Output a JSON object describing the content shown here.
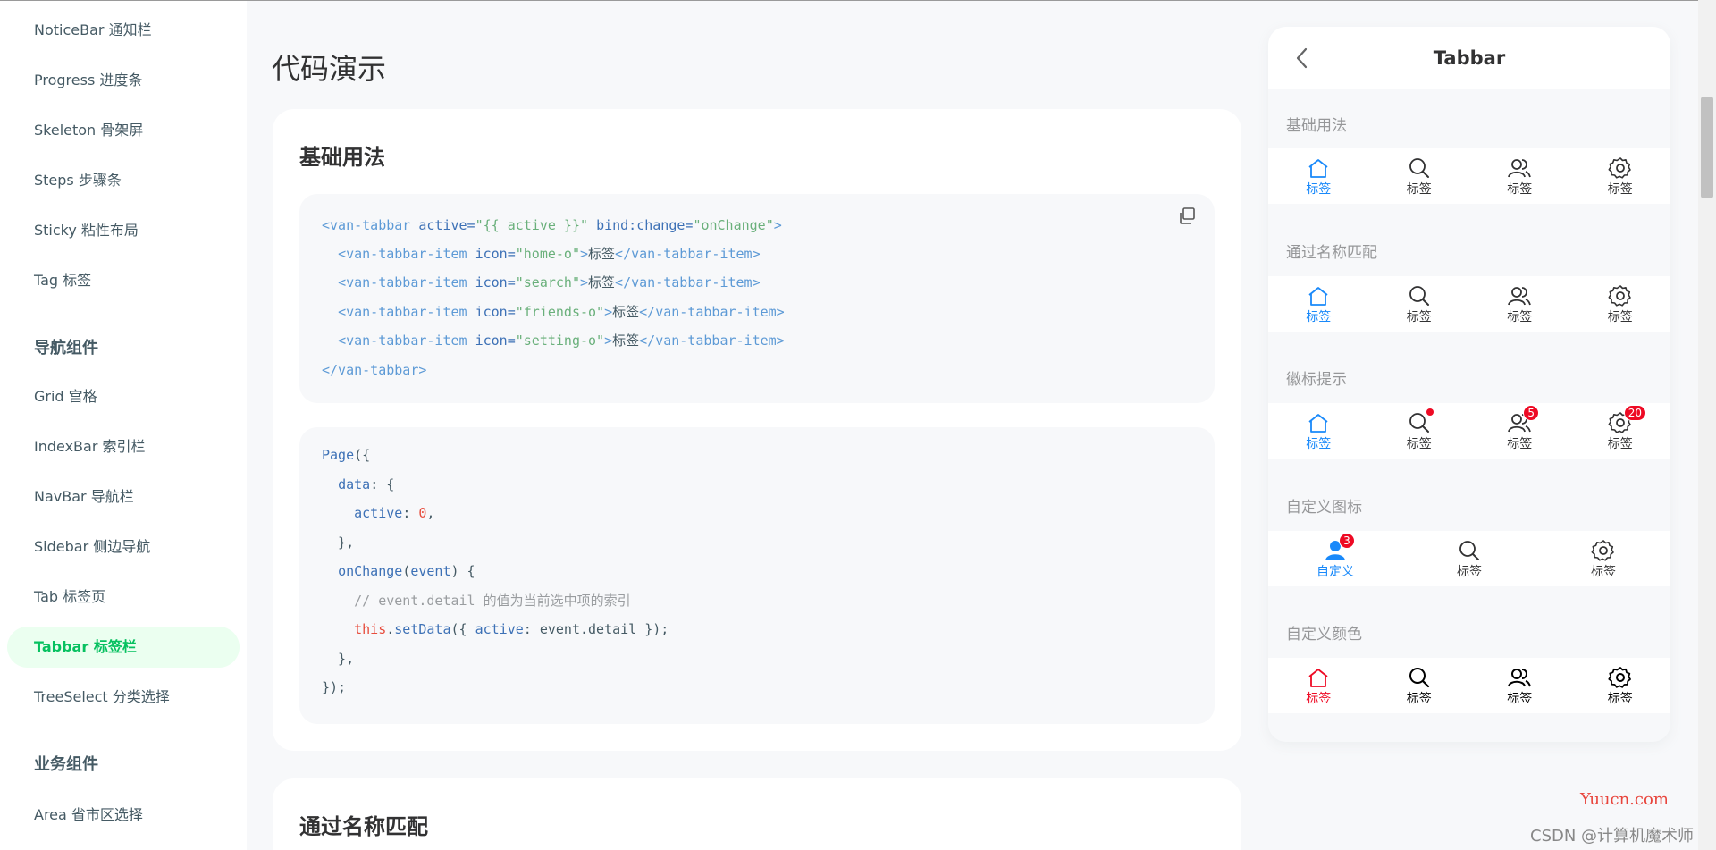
{
  "sidebar": {
    "items": [
      {
        "label": "NoticeBar 通知栏"
      },
      {
        "label": "Progress 进度条"
      },
      {
        "label": "Skeleton 骨架屏"
      },
      {
        "label": "Steps 步骤条"
      },
      {
        "label": "Sticky 粘性布局"
      },
      {
        "label": "Tag 标签"
      }
    ],
    "group_nav": "导航组件",
    "nav_items": [
      {
        "label": "Grid 宫格"
      },
      {
        "label": "IndexBar 索引栏"
      },
      {
        "label": "NavBar 导航栏"
      },
      {
        "label": "Sidebar 侧边导航"
      },
      {
        "label": "Tab 标签页"
      },
      {
        "label": "Tabbar 标签栏"
      },
      {
        "label": "TreeSelect 分类选择"
      }
    ],
    "group_business": "业务组件",
    "business_items": [
      {
        "label": "Area 省市区选择"
      }
    ],
    "active_color": "#07c160"
  },
  "main": {
    "page_title": "代码演示",
    "card1_title": "基础用法",
    "card2_title": "通过名称匹配",
    "code1": [
      "<van-tabbar active=\"{{ active }}\" bind:change=\"onChange\">",
      "  <van-tabbar-item icon=\"home-o\">标签</van-tabbar-item>",
      "  <van-tabbar-item icon=\"search\">标签</van-tabbar-item>",
      "  <van-tabbar-item icon=\"friends-o\">标签</van-tabbar-item>",
      "  <van-tabbar-item icon=\"setting-o\">标签</van-tabbar-item>",
      "</van-tabbar>"
    ],
    "code2": [
      "Page({",
      "  data: {",
      "    active: 0,",
      "  },",
      "  onChange(event) {",
      "    // event.detail 的值为当前选中项的索引",
      "    this.setData({ active: event.detail });",
      "  },",
      "});"
    ],
    "copy_icon": "copy-icon"
  },
  "simulator": {
    "title": "Tabbar",
    "back_icon": "chevron-left-icon",
    "sections": [
      {
        "title": "基础用法",
        "items": [
          {
            "icon": "home-o",
            "label": "标签"
          },
          {
            "icon": "search",
            "label": "标签"
          },
          {
            "icon": "friends-o",
            "label": "标签"
          },
          {
            "icon": "setting-o",
            "label": "标签"
          }
        ]
      },
      {
        "title": "通过名称匹配",
        "items": [
          {
            "icon": "home-o",
            "label": "标签"
          },
          {
            "icon": "search",
            "label": "标签"
          },
          {
            "icon": "friends-o",
            "label": "标签"
          },
          {
            "icon": "setting-o",
            "label": "标签"
          }
        ]
      },
      {
        "title": "徽标提示",
        "items": [
          {
            "icon": "home-o",
            "label": "标签"
          },
          {
            "icon": "search",
            "label": "标签",
            "dot": true
          },
          {
            "icon": "friends-o",
            "label": "标签",
            "badge": "5"
          },
          {
            "icon": "setting-o",
            "label": "标签",
            "badge": "20"
          }
        ]
      },
      {
        "title": "自定义图标",
        "items": [
          {
            "icon": "custom-user",
            "label": "自定义",
            "badge": "3"
          },
          {
            "icon": "search",
            "label": "标签"
          },
          {
            "icon": "setting-o",
            "label": "标签"
          }
        ]
      },
      {
        "title": "自定义颜色",
        "items": [
          {
            "icon": "home-o",
            "label": "标签"
          },
          {
            "icon": "search",
            "label": "标签"
          },
          {
            "icon": "friends-o",
            "label": "标签"
          },
          {
            "icon": "setting-o",
            "label": "标签"
          }
        ]
      }
    ],
    "active_blue": "#1989fa",
    "active_red": "#ee0a24"
  },
  "watermark": {
    "site": "Yuucn.com",
    "author": "CSDN @计算机魔术师"
  }
}
